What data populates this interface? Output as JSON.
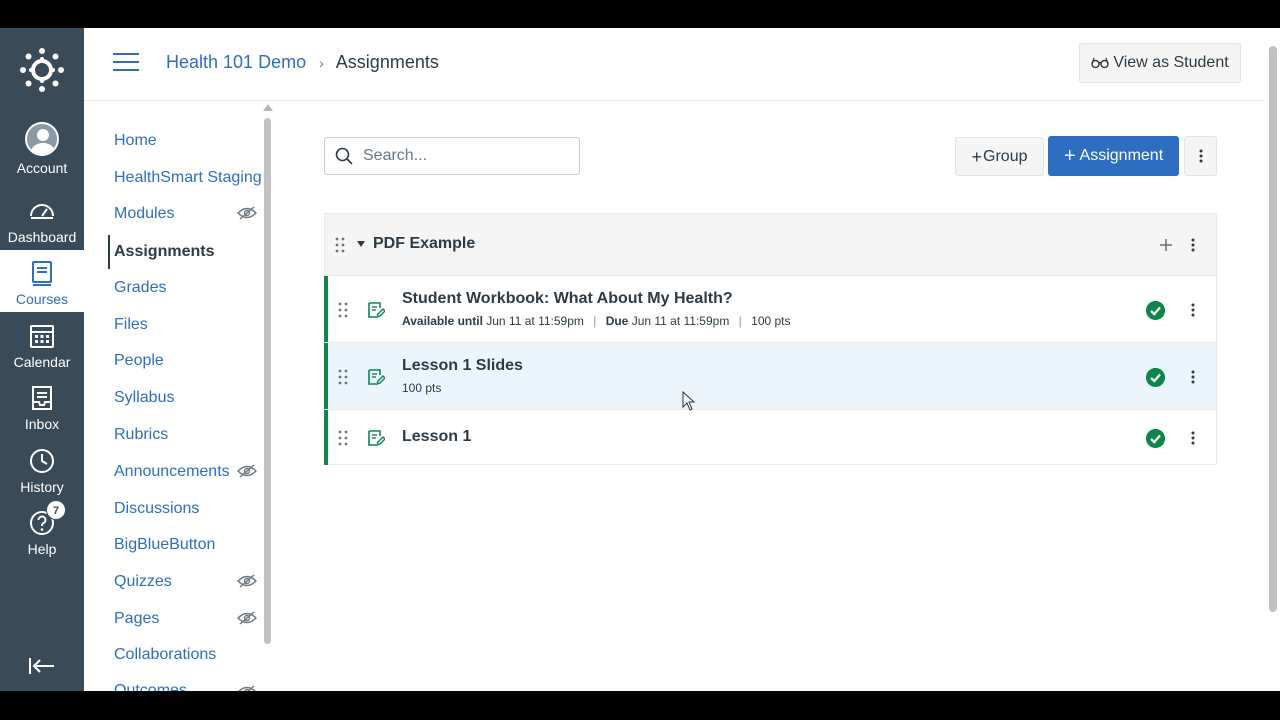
{
  "global_nav": {
    "items": [
      {
        "label": "Account",
        "icon": "user-avatar-icon"
      },
      {
        "label": "Dashboard",
        "icon": "dashboard-icon"
      },
      {
        "label": "Courses",
        "icon": "courses-icon"
      },
      {
        "label": "Calendar",
        "icon": "calendar-icon"
      },
      {
        "label": "Inbox",
        "icon": "inbox-icon"
      },
      {
        "label": "History",
        "icon": "clock-icon"
      },
      {
        "label": "Help",
        "icon": "help-icon",
        "badge": "7"
      }
    ]
  },
  "header": {
    "course_name": "Health 101 Demo",
    "page_name": "Assignments",
    "separator": "›",
    "view_as_student": "View as Student"
  },
  "course_nav": {
    "items": [
      {
        "label": "Home"
      },
      {
        "label": "HealthSmart Staging"
      },
      {
        "label": "Modules",
        "hidden": true
      },
      {
        "label": "Assignments",
        "active": true
      },
      {
        "label": "Grades"
      },
      {
        "label": "Files"
      },
      {
        "label": "People"
      },
      {
        "label": "Syllabus"
      },
      {
        "label": "Rubrics"
      },
      {
        "label": "Announcements",
        "hidden": true
      },
      {
        "label": "Discussions"
      },
      {
        "label": "BigBlueButton"
      },
      {
        "label": "Quizzes",
        "hidden": true
      },
      {
        "label": "Pages",
        "hidden": true
      },
      {
        "label": "Collaborations"
      },
      {
        "label": "Outcomes",
        "hidden": true
      }
    ]
  },
  "toolbar": {
    "search_placeholder": "Search...",
    "group_button": "Group",
    "assignment_button": "Assignment"
  },
  "group": {
    "title": "PDF Example",
    "assignments": [
      {
        "title": "Student Workbook: What About My Health?",
        "available_label": "Available until",
        "available_value": "Jun 11 at 11:59pm",
        "due_label": "Due",
        "due_value": "Jun 11 at 11:59pm",
        "points": "100 pts",
        "published": true
      },
      {
        "title": "Lesson 1 Slides",
        "points": "100 pts",
        "published": true
      },
      {
        "title": "Lesson 1",
        "published": true
      }
    ]
  },
  "colors": {
    "nav_bg": "#394b58",
    "link": "#2d6ec0",
    "primary_button": "#2d6ec0",
    "published_green": "#0b874b",
    "text": "#2d3b45"
  }
}
